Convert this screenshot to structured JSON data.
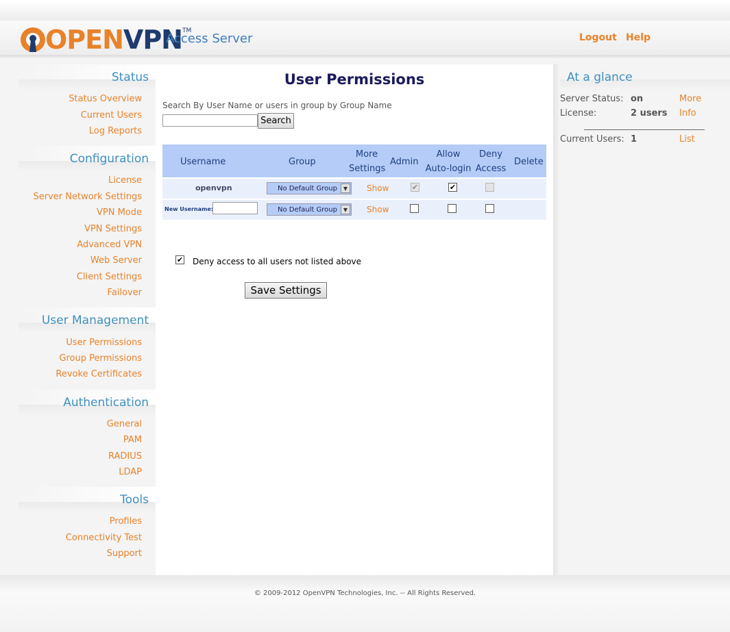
{
  "header": {
    "logo_open": "OPEN",
    "logo_vpn": "VPN",
    "logo_tm": "TM",
    "subtitle": "Access Server",
    "logout": "Logout",
    "help": "Help"
  },
  "sidebar": {
    "sections": [
      {
        "title": "Status",
        "items": [
          "Status Overview",
          "Current Users",
          "Log Reports"
        ]
      },
      {
        "title": "Configuration",
        "items": [
          "License",
          "Server Network Settings",
          "VPN Mode",
          "VPN Settings",
          "Advanced VPN",
          "Web Server",
          "Client Settings",
          "Failover"
        ]
      },
      {
        "title": "User Management",
        "items": [
          "User Permissions",
          "Group Permissions",
          "Revoke Certificates"
        ]
      },
      {
        "title": "Authentication",
        "items": [
          "General",
          "PAM",
          "RADIUS",
          "LDAP"
        ]
      },
      {
        "title": "Tools",
        "items": [
          "Profiles",
          "Connectivity Test",
          "Support"
        ]
      }
    ]
  },
  "main": {
    "title": "User Permissions",
    "search_label": "Search By User Name or users in group by Group Name",
    "search_value": "",
    "search_button": "Search",
    "columns": {
      "username": "Username",
      "group": "Group",
      "more_1": "More",
      "more_2": "Settings",
      "admin": "Admin",
      "allow_1": "Allow",
      "allow_2": "Auto-login",
      "deny_1": "Deny",
      "deny_2": "Access",
      "delete": "Delete"
    },
    "rows": [
      {
        "username": "openvpn",
        "group": "No Default Group",
        "more": "Show",
        "admin": true,
        "admin_disabled": true,
        "autologin": true,
        "deny": false,
        "deny_disabled": true
      }
    ],
    "new_row": {
      "label": "New Username:",
      "value": "",
      "group": "No Default Group",
      "more": "Show",
      "admin": false,
      "autologin": false,
      "deny": false
    },
    "deny_all_label": "Deny access to all users not listed above",
    "deny_all_checked": true,
    "save_button": "Save Settings"
  },
  "glance": {
    "title": "At a glance",
    "server_status_label": "Server Status:",
    "server_status_value": "on",
    "server_status_link": "More",
    "license_label": "License:",
    "license_value": "2 users",
    "license_link": "Info",
    "current_users_label": "Current Users:",
    "current_users_value": "1",
    "current_users_link": "List"
  },
  "footer": {
    "copyright": "© 2009-2012 OpenVPN Technologies, Inc. -- All Rights Reserved."
  },
  "colors": {
    "accent_orange": "#e8822a",
    "brand_navy": "#1d3b6e",
    "section_blue": "#3d8fbf",
    "table_header": "#b4ccf7",
    "row_bg": "#eaf0fb"
  }
}
